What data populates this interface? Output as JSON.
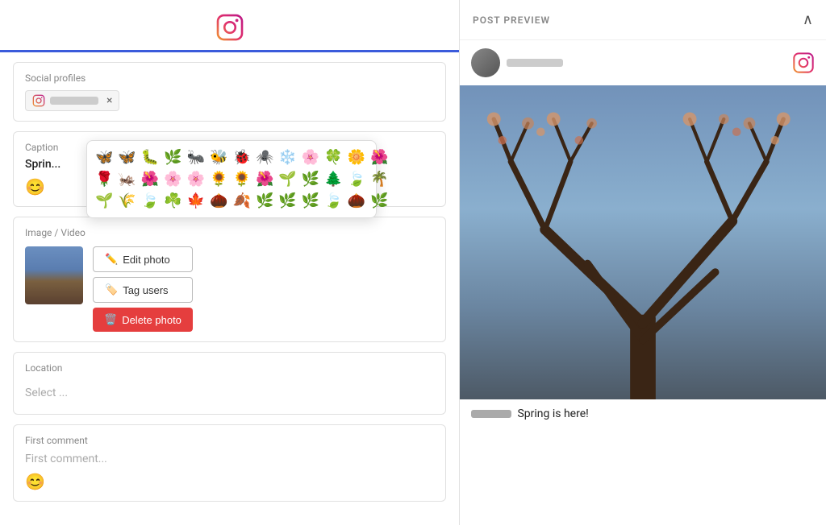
{
  "header": {
    "logo_alt": "Instagram Logo"
  },
  "left": {
    "social_profiles": {
      "label": "Social profiles",
      "profile_name_placeholder": "username"
    },
    "caption": {
      "label": "Caption",
      "text": "Sprin...",
      "emoji_label": "😊"
    },
    "emoji_picker": {
      "rows": [
        [
          "🦋",
          "🦋",
          "🐛",
          "🌿",
          "🐜",
          "🐝",
          "🐞",
          "🕷️",
          "❄️",
          "🌸"
        ],
        [
          "🌸",
          "🌸",
          "🌺",
          "🌹",
          "🌿",
          "🌺",
          "🌻",
          "🌻",
          "🌹",
          "🌱"
        ],
        [
          "🌲",
          "🍀",
          "🌴",
          "🌱",
          "🌾",
          "🍃",
          "☘️",
          "🍁",
          "🌰"
        ]
      ],
      "all_emojis": [
        "🦋",
        "🐛",
        "🌿",
        "🐜",
        "🐝",
        "🐞",
        "🕷️",
        "❄️",
        "🌸",
        "🌸",
        "🌸",
        "🌺",
        "🌹",
        "🌿",
        "🌺",
        "🌻",
        "🌻",
        "🌹",
        "🌱",
        "🌲",
        "🍀",
        "🌴",
        "🌱",
        "🌾",
        "🍃",
        "☘️",
        "🍁",
        "🌰",
        "🌿",
        "🦗",
        "🌼",
        "🌺",
        "🌸",
        "🐞",
        "🌿",
        "🍂",
        "🍃"
      ]
    },
    "image_video": {
      "label": "Image / Video",
      "edit_button": "Edit photo",
      "tag_button": "Tag users",
      "delete_button": "Delete photo"
    },
    "location": {
      "label": "Location",
      "placeholder": "Select ..."
    },
    "first_comment": {
      "label": "First comment",
      "placeholder": "First comment..."
    }
  },
  "right": {
    "header": {
      "title": "POST PREVIEW",
      "chevron": "∧"
    },
    "caption_text": "Spring is here!"
  },
  "colors": {
    "accent_blue": "#3b5bdb",
    "danger_red": "#e53e3e",
    "ig_gradient_start": "#f09433",
    "ig_gradient_end": "#bc1888"
  }
}
